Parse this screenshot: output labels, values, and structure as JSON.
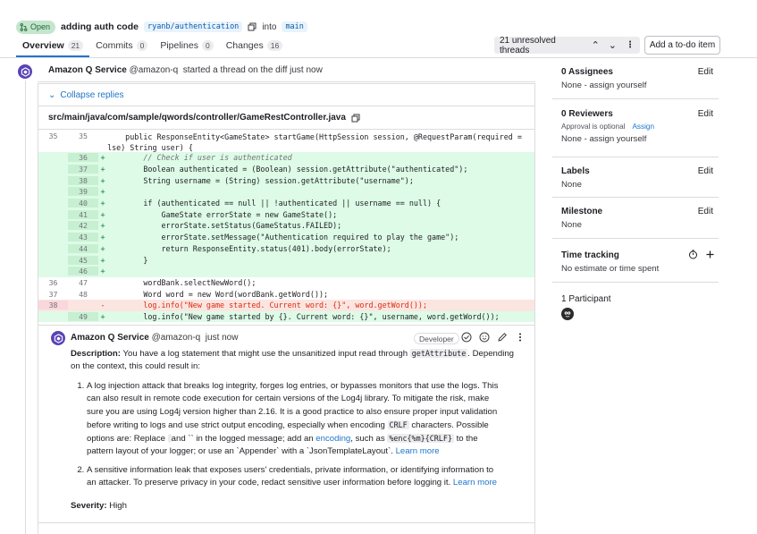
{
  "header": {
    "status": "Open",
    "title": "adding auth code",
    "source_branch": "ryanb/authentication",
    "into_label": "into",
    "target_branch": "main"
  },
  "tabs": [
    {
      "label": "Overview",
      "count": "21"
    },
    {
      "label": "Commits",
      "count": "0"
    },
    {
      "label": "Pipelines",
      "count": "0"
    },
    {
      "label": "Changes",
      "count": "16"
    }
  ],
  "threads_label": "21 unresolved threads",
  "todo_button": "Add a to-do item",
  "thread": {
    "author": "Amazon Q Service",
    "handle": "@amazon-q",
    "action": "started a thread on the diff",
    "time": "just now",
    "collapse_label": "Collapse replies",
    "file_path": "src/main/java/com/sample/qwords/controller/GameRestController.java"
  },
  "diff": [
    {
      "type": "ctx",
      "old": "35",
      "new": "35",
      "sign": " ",
      "code": "    public ResponseEntity<GameState> startGame(HttpSession session, @RequestParam(required =",
      "cont": "false) String user) {"
    },
    {
      "type": "add",
      "old": "",
      "new": "36",
      "sign": "+",
      "code": "        // Check if user is authenticated"
    },
    {
      "type": "add",
      "old": "",
      "new": "37",
      "sign": "+",
      "code": "        Boolean authenticated = (Boolean) session.getAttribute(\"authenticated\");"
    },
    {
      "type": "add",
      "old": "",
      "new": "38",
      "sign": "+",
      "code": "        String username = (String) session.getAttribute(\"username\");"
    },
    {
      "type": "add",
      "old": "",
      "new": "39",
      "sign": "+",
      "code": ""
    },
    {
      "type": "add",
      "old": "",
      "new": "40",
      "sign": "+",
      "code": "        if (authenticated == null || !authenticated || username == null) {"
    },
    {
      "type": "add",
      "old": "",
      "new": "41",
      "sign": "+",
      "code": "            GameState errorState = new GameState();"
    },
    {
      "type": "add",
      "old": "",
      "new": "42",
      "sign": "+",
      "code": "            errorState.setStatus(GameStatus.FAILED);"
    },
    {
      "type": "add",
      "old": "",
      "new": "43",
      "sign": "+",
      "code": "            errorState.setMessage(\"Authentication required to play the game\");"
    },
    {
      "type": "add",
      "old": "",
      "new": "44",
      "sign": "+",
      "code": "            return ResponseEntity.status(401).body(errorState);"
    },
    {
      "type": "add",
      "old": "",
      "new": "45",
      "sign": "+",
      "code": "        }"
    },
    {
      "type": "add",
      "old": "",
      "new": "46",
      "sign": "+",
      "code": ""
    },
    {
      "type": "ctx",
      "old": "36",
      "new": "47",
      "sign": " ",
      "code": "        wordBank.selectNewWord();"
    },
    {
      "type": "ctx",
      "old": "37",
      "new": "48",
      "sign": " ",
      "code": "        Word word = new Word(wordBank.getWord());"
    },
    {
      "type": "del",
      "old": "38",
      "new": "",
      "sign": "-",
      "code": "        log.info(\"New game started. Current word: {}\", word.getWord());"
    },
    {
      "type": "add",
      "old": "",
      "new": "49",
      "sign": "+",
      "code": "        log.info(\"New game started by {}. Current word: {}\", username, word.getWord());"
    }
  ],
  "reply": {
    "author": "Amazon Q Service",
    "handle": "@amazon-q",
    "time": "just now",
    "badge": "Developer",
    "description_label": "Description:",
    "description_pre": "You have a log statement that might use the unsanitized input read through",
    "description_code": "getAttribute",
    "description_post": ". Depending on the context, this could result in:",
    "issue1_a": "A log injection attack that breaks log integrity, forges log entries, or bypasses monitors that use the logs. This can also result in remote code execution for certain versions of the Log4j library. To mitigate the risk, make sure you are using Log4j version higher than 2.16. It is a good practice to also ensure proper input validation before writing to logs and use strict output encoding, especially when encoding",
    "issue1_code1": "CRLF",
    "issue1_b": "characters. Possible options are: Replace",
    "issue1_code2": " ",
    "issue1_c": "and `` in the logged message; add an",
    "issue1_link1": "encoding",
    "issue1_d": ", such as",
    "issue1_code3": "%enc{%m}{CRLF}",
    "issue1_e": "to the pattern layout of your logger; or use an `Appender` with a `JsonTemplateLayout`.",
    "issue1_learn": "Learn more",
    "issue2": "A sensitive information leak that exposes users' credentials, private information, or identifying information to an attacker. To preserve privacy in your code, redact sensitive user information before logging it.",
    "issue2_learn": "Learn more",
    "severity_label": "Severity:",
    "severity_value": "High"
  },
  "sidebar": {
    "assignees_title": "0 Assignees",
    "assignees_edit": "Edit",
    "assignees_value": "None - assign yourself",
    "reviewers_title": "0 Reviewers",
    "reviewers_edit": "Edit",
    "reviewers_optional": "Approval is optional",
    "reviewers_assign": "Assign",
    "reviewers_value": "None - assign yourself",
    "labels_title": "Labels",
    "labels_edit": "Edit",
    "labels_value": "None",
    "milestone_title": "Milestone",
    "milestone_edit": "Edit",
    "milestone_value": "None",
    "time_title": "Time tracking",
    "time_value": "No estimate or time spent",
    "participants_title": "1 Participant"
  },
  "colors": {
    "accent": "#1f75cb",
    "added_bg": "#ddfbe6",
    "removed_bg": "#fbe5e1",
    "open_badge": "#c3e6cd",
    "amazon_q": "#5943b6"
  }
}
